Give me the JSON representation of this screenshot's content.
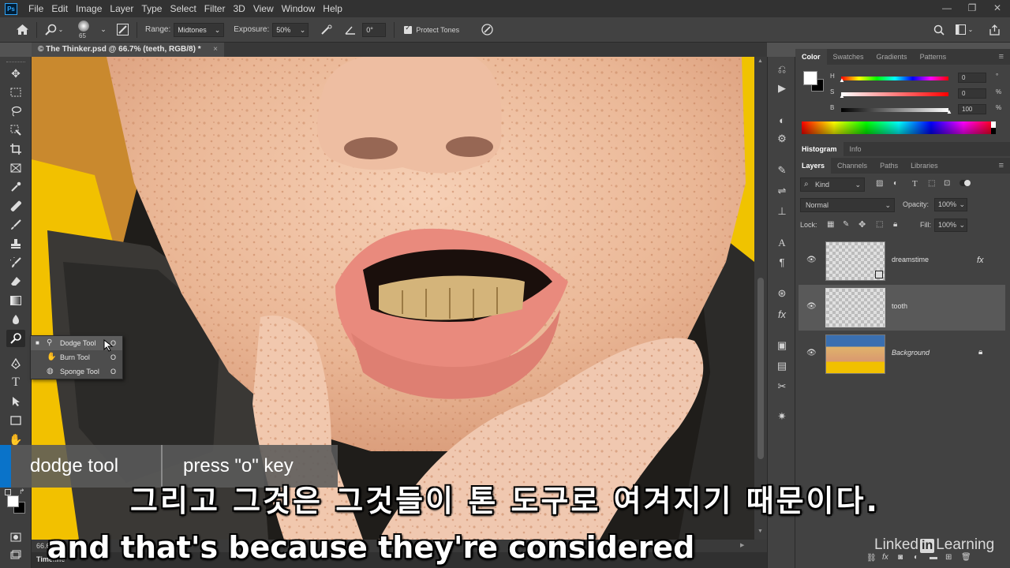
{
  "app": {
    "logo": "Ps",
    "menus": [
      "File",
      "Edit",
      "Image",
      "Layer",
      "Type",
      "Select",
      "Filter",
      "3D",
      "View",
      "Window",
      "Help"
    ]
  },
  "options": {
    "brush_size": "65",
    "range_label": "Range:",
    "range_value": "Midtones",
    "exposure_label": "Exposure:",
    "exposure_value": "50%",
    "angle_value": "0°",
    "protect_tones": "Protect Tones"
  },
  "document": {
    "tab_title": "© The Thinker.psd @ 66.7% (teeth, RGB/8) *",
    "close": "×",
    "zoom": "66.67%"
  },
  "flyout": {
    "items": [
      {
        "label": "Dodge Tool",
        "key": "O"
      },
      {
        "label": "Burn Tool",
        "key": "O"
      },
      {
        "label": "Sponge Tool",
        "key": "O"
      }
    ]
  },
  "timeline": {
    "label": "Timeline"
  },
  "color_panel": {
    "tabs": [
      "Color",
      "Swatches",
      "Gradients",
      "Patterns"
    ],
    "h_label": "H",
    "s_label": "S",
    "b_label": "B",
    "h_value": "0",
    "s_value": "0",
    "b_value": "100",
    "h_unit": "°",
    "s_unit": "%",
    "b_unit": "%"
  },
  "mid_tabs": [
    "Histogram",
    "Info"
  ],
  "layers_panel": {
    "tabs": [
      "Layers",
      "Channels",
      "Paths",
      "Libraries"
    ],
    "kind": "Kind",
    "blend": "Normal",
    "opacity_label": "Opacity:",
    "opacity": "100%",
    "lock_label": "Lock:",
    "fill_label": "Fill:",
    "fill": "100%",
    "layers": [
      {
        "name": "dreamstime",
        "fx": "fx"
      },
      {
        "name": "tooth"
      },
      {
        "name": "Background"
      }
    ]
  },
  "overlay": {
    "left": "dodge tool",
    "right": "press \"o\" key"
  },
  "subtitles": {
    "korean": "그리고 그것은 그것들이 톤 도구로 여겨지기 때문이다.",
    "english": "and that's because they're considered"
  },
  "watermark": {
    "pre": "Linked",
    "in": "in",
    "post": "Learning"
  }
}
